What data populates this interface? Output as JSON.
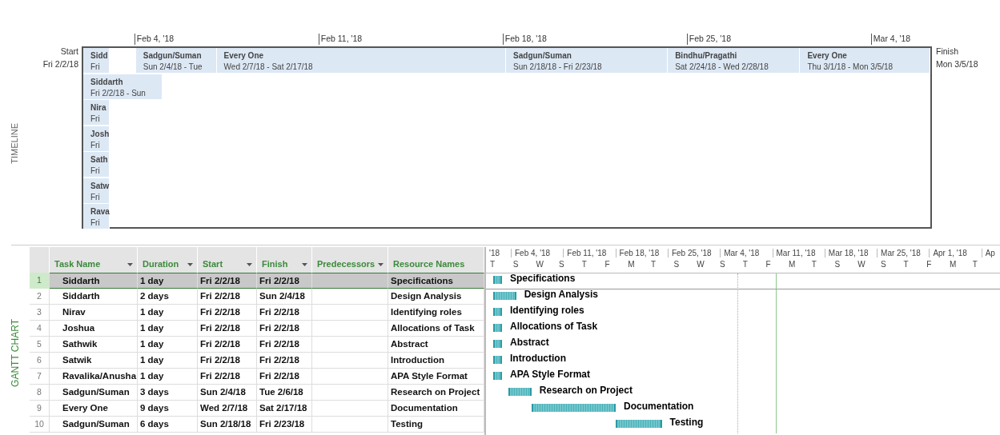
{
  "timeline": {
    "side_label": "TIMELINE",
    "start": {
      "label": "Start",
      "date": "Fri 2/2/18"
    },
    "finish": {
      "label": "Finish",
      "date": "Mon 3/5/18"
    },
    "ticks": [
      "Feb 4, '18",
      "Feb 11, '18",
      "Feb 18, '18",
      "Feb 25, '18",
      "Mar 4, '18"
    ],
    "bars": [
      {
        "name": "Sidd",
        "dates": "Fri"
      },
      {
        "name": "Sadgun/Suman",
        "dates": "Sun 2/4/18 - Tue"
      },
      {
        "name": "Every One",
        "dates": "Wed 2/7/18 - Sat 2/17/18"
      },
      {
        "name": "Sadgun/Suman",
        "dates": "Sun 2/18/18 - Fri 2/23/18"
      },
      {
        "name": "Bindhu/Pragathi",
        "dates": "Sat 2/24/18 - Wed 2/28/18"
      },
      {
        "name": "Every One",
        "dates": "Thu 3/1/18 - Mon 3/5/18"
      },
      {
        "name": "Siddarth",
        "dates": "Fri 2/2/18 - Sun"
      },
      {
        "name": "Nira",
        "dates": "Fri"
      },
      {
        "name": "Josh",
        "dates": "Fri"
      },
      {
        "name": "Sath",
        "dates": "Fri"
      },
      {
        "name": "Satw",
        "dates": "Fri"
      },
      {
        "name": "Rava",
        "dates": "Fri"
      }
    ]
  },
  "gantt": {
    "side_label": "GANTT CHART",
    "columns": [
      {
        "label": "Task Name",
        "dropdown": true
      },
      {
        "label": "Duration",
        "dropdown": true
      },
      {
        "label": "Start",
        "dropdown": true
      },
      {
        "label": "Finish",
        "dropdown": true
      },
      {
        "label": "Predecessors",
        "dropdown": true
      },
      {
        "label": "Resource Names",
        "dropdown": false
      }
    ],
    "rows": [
      {
        "id": "1",
        "task": "Siddarth",
        "duration": "1 day",
        "start": "Fri 2/2/18",
        "finish": "Fri 2/2/18",
        "resource": "Specifications",
        "selected": true
      },
      {
        "id": "2",
        "task": "Siddarth",
        "duration": "2 days",
        "start": "Fri 2/2/18",
        "finish": "Sun 2/4/18",
        "resource": "Design Analysis",
        "selected": false
      },
      {
        "id": "3",
        "task": "Nirav",
        "duration": "1 day",
        "start": "Fri 2/2/18",
        "finish": "Fri 2/2/18",
        "resource": "Identifying roles",
        "selected": false
      },
      {
        "id": "4",
        "task": "Joshua",
        "duration": "1 day",
        "start": "Fri 2/2/18",
        "finish": "Fri 2/2/18",
        "resource": "Allocations of Task",
        "selected": false
      },
      {
        "id": "5",
        "task": "Sathwik",
        "duration": "1 day",
        "start": "Fri 2/2/18",
        "finish": "Fri 2/2/18",
        "resource": "Abstract",
        "selected": false
      },
      {
        "id": "6",
        "task": "Satwik",
        "duration": "1 day",
        "start": "Fri 2/2/18",
        "finish": "Fri 2/2/18",
        "resource": "Introduction",
        "selected": false
      },
      {
        "id": "7",
        "task": "Ravalika/Anusha",
        "duration": "1 day",
        "start": "Fri 2/2/18",
        "finish": "Fri 2/2/18",
        "resource": "APA Style Format",
        "selected": false
      },
      {
        "id": "8",
        "task": "Sadgun/Suman",
        "duration": "3 days",
        "start": "Sun 2/4/18",
        "finish": "Tue 2/6/18",
        "resource": "Research on Project",
        "selected": false
      },
      {
        "id": "9",
        "task": "Every One",
        "duration": "9 days",
        "start": "Wed 2/7/18",
        "finish": "Sat 2/17/18",
        "resource": "Documentation",
        "selected": false
      },
      {
        "id": "10",
        "task": "Sadgun/Suman",
        "duration": "6 days",
        "start": "Sun 2/18/18",
        "finish": "Fri 2/23/18",
        "resource": "Testing",
        "selected": false
      }
    ],
    "weeks": [
      "'18",
      "Feb 4, '18",
      "Feb 11, '18",
      "Feb 18, '18",
      "Feb 25, '18",
      "Mar 4, '18",
      "Mar 11, '18",
      "Mar 18, '18",
      "Mar 25, '18",
      "Apr 1, '18",
      "Ap"
    ],
    "days": [
      "T",
      "S",
      "W",
      "S",
      "T",
      "F",
      "M",
      "T",
      "S",
      "W",
      "S",
      "T",
      "F",
      "M",
      "T",
      "S",
      "W",
      "S",
      "T",
      "F",
      "M",
      "T"
    ],
    "bar_labels": [
      "Specifications",
      "Design Analysis",
      "Identifying roles",
      "Allocations of Task",
      "Abstract",
      "Introduction",
      "APA Style Format",
      "Research on Project",
      "Documentation",
      "Testing"
    ]
  }
}
